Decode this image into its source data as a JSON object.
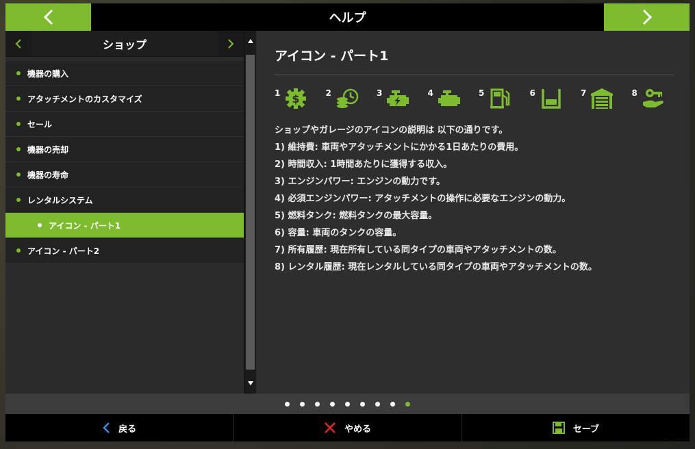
{
  "header": {
    "title": "ヘルプ"
  },
  "category": {
    "title": "ショップ"
  },
  "menu": [
    {
      "label": "機器の購入",
      "active": false
    },
    {
      "label": "アタッチメントのカスタマイズ",
      "active": false
    },
    {
      "label": "セール",
      "active": false
    },
    {
      "label": "機器の売却",
      "active": false
    },
    {
      "label": "機器の寿命",
      "active": false
    },
    {
      "label": "レンタルシステム",
      "active": false
    },
    {
      "label": "アイコン - パート1",
      "active": true
    },
    {
      "label": "アイコン - パート2",
      "active": false
    }
  ],
  "content": {
    "title": "アイコン - パート1",
    "icons": [
      {
        "num": "1",
        "icon": "money-gear-icon"
      },
      {
        "num": "2",
        "icon": "coins-clock-icon"
      },
      {
        "num": "3",
        "icon": "engine-bolt-icon"
      },
      {
        "num": "4",
        "icon": "engine-icon"
      },
      {
        "num": "5",
        "icon": "fuel-pump-icon"
      },
      {
        "num": "6",
        "icon": "tank-capacity-icon"
      },
      {
        "num": "7",
        "icon": "garage-icon"
      },
      {
        "num": "8",
        "icon": "hand-key-icon"
      }
    ],
    "lines": [
      "ショップやガレージのアイコンの説明は 以下の通りです。",
      "1) 維持費: 車両やアタッチメントにかかる1日あたりの費用。",
      "2) 時間収入: 1時間あたりに獲得する収入。",
      "3) エンジンパワー: エンジンの動力です。",
      "4) 必須エンジンパワー: アタッチメントの操作に必要なエンジンの動力。",
      "5) 燃料タンク: 燃料タンクの最大容量。",
      "6) 容量: 車両のタンクの容量。",
      "7) 所有履歴: 現在所有している同タイプの車両やアタッチメントの数。",
      "8) レンタル履歴: 現在レンタルしている同タイプの車両やアタッチメントの数。"
    ]
  },
  "pager": {
    "total": 9,
    "active_index": 8
  },
  "footer": {
    "back_label": "戻る",
    "cancel_label": "やめる",
    "save_label": "セーブ"
  },
  "colors": {
    "accent": "#7dbb2f",
    "back_icon": "#3a8fd6",
    "cancel_icon": "#e02a2a"
  }
}
